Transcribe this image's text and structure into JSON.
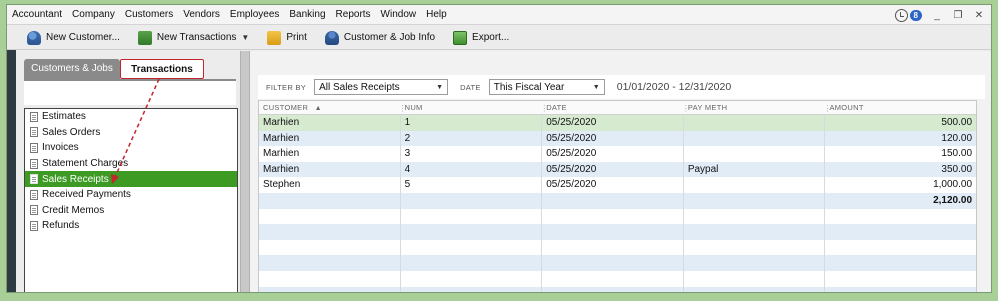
{
  "menubar": {
    "items": [
      "Accountant",
      "Company",
      "Customers",
      "Vendors",
      "Employees",
      "Banking",
      "Reports",
      "Window",
      "Help"
    ],
    "notification_count": "8",
    "window_controls": [
      "_",
      "❐",
      "✕"
    ]
  },
  "toolbar": {
    "new_customer": "New Customer...",
    "new_transactions": "New Transactions",
    "print": "Print",
    "customer_job_info": "Customer & Job Info",
    "export": "Export..."
  },
  "left_panel": {
    "tabs": [
      "Customers & Jobs",
      "Transactions"
    ],
    "active_tab": "Transactions",
    "transaction_types": [
      "Estimates",
      "Sales Orders",
      "Invoices",
      "Statement Charges",
      "Sales Receipts",
      "Received Payments",
      "Credit Memos",
      "Refunds"
    ],
    "selected_type": "Sales Receipts"
  },
  "filter": {
    "filter_by_label": "FILTER BY",
    "filter_by_value": "All Sales Receipts",
    "date_label": "DATE",
    "date_value": "This Fiscal Year",
    "date_range": "01/01/2020 - 12/31/2020"
  },
  "table": {
    "columns": [
      "CUSTOMER",
      "NUM",
      "DATE",
      "PAY METH",
      "AMOUNT"
    ],
    "sort_indicator": "▲",
    "rows": [
      {
        "customer": "Marhien",
        "num": "1",
        "date": "05/25/2020",
        "pay_meth": "",
        "amount": "500.00"
      },
      {
        "customer": "Marhien",
        "num": "2",
        "date": "05/25/2020",
        "pay_meth": "",
        "amount": "120.00"
      },
      {
        "customer": "Marhien",
        "num": "3",
        "date": "05/25/2020",
        "pay_meth": "",
        "amount": "150.00"
      },
      {
        "customer": "Marhien",
        "num": "4",
        "date": "05/25/2020",
        "pay_meth": "Paypal",
        "amount": "350.00"
      },
      {
        "customer": "Stephen",
        "num": "5",
        "date": "05/25/2020",
        "pay_meth": "",
        "amount": "1,000.00"
      }
    ],
    "total": "2,120.00"
  },
  "colors": {
    "selected_item": "#3d9a22",
    "selected_row": "#d6ead0",
    "alt_row": "#e2ecf7",
    "annotation": "#c0262b"
  }
}
